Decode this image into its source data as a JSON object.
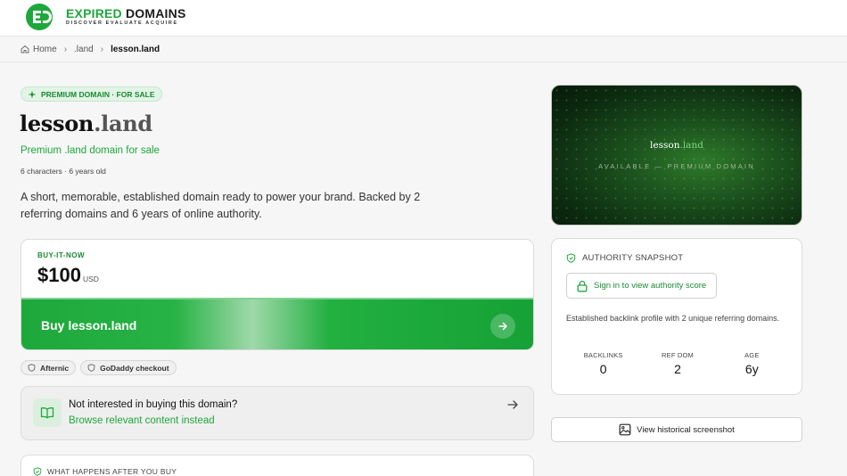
{
  "header": {
    "logo": {
      "title_part1": "EXPIRED",
      "title_part2": "DOMAINS",
      "tagline": "DISCOVER EVALUATE ACQUIRE",
      "icon": "expired-domains-logo-icon"
    }
  },
  "breadcrumb": {
    "home": "Home",
    "tld": ".land",
    "current": "lesson.land"
  },
  "listing": {
    "badge": "PREMIUM DOMAIN · FOR SALE",
    "name": "lesson",
    "tld": ".land",
    "subtitle": "Premium .land domain for sale",
    "meta": "6 characters · 6 years old",
    "description": "A short, memorable, established domain ready to power your brand. Backed by 2 referring domains and 6 years of online authority."
  },
  "buy": {
    "label": "BUY-IT-NOW",
    "price": "$100",
    "currency": "USD",
    "button": "Buy lesson.land",
    "chips": [
      "Afternic",
      "GoDaddy checkout"
    ]
  },
  "alternative": {
    "title": "Not interested in buying this domain?",
    "link": "Browse relevant content instead"
  },
  "after": {
    "title": "WHAT HAPPENS AFTER YOU BUY"
  },
  "hero": {
    "name": "lesson",
    "tld": ".land",
    "tag": "AVAILABLE — PREMIUM DOMAIN"
  },
  "authority": {
    "title": "AUTHORITY SNAPSHOT",
    "signin": "Sign in to view authority score",
    "description": "Established backlink profile with 2 unique referring domains.",
    "stats": [
      {
        "label": "BACKLINKS",
        "value": "0"
      },
      {
        "label": "REF DOM",
        "value": "2"
      },
      {
        "label": "AGE",
        "value": "6y"
      }
    ]
  },
  "history": {
    "button": "View historical screenshot"
  },
  "colors": {
    "brand_green": "#1ea83b",
    "dark_green": "#1a8a33",
    "hero_bg": "#0c2a10"
  }
}
